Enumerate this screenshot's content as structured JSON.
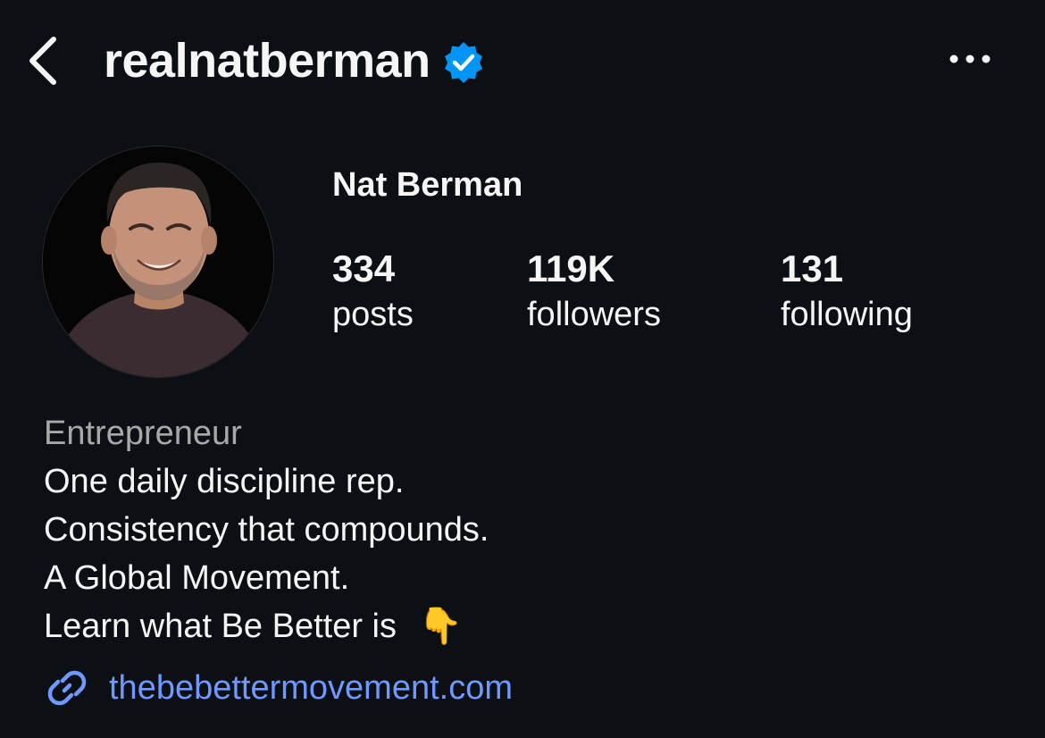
{
  "header": {
    "username": "realnatberman",
    "verified_icon": "verified-badge-icon",
    "back_icon": "chevron-left-icon",
    "more_icon": "more-options-icon",
    "accent_color": "#0095f6"
  },
  "profile": {
    "display_name": "Nat Berman",
    "stats": [
      {
        "value": "334",
        "label": "posts"
      },
      {
        "value": "119K",
        "label": "followers"
      },
      {
        "value": "131",
        "label": "following"
      }
    ]
  },
  "bio": {
    "category": "Entrepreneur",
    "lines": [
      "One daily discipline rep.",
      "Consistency that compounds.",
      "A Global Movement.",
      "Learn what Be Better is"
    ],
    "emoji": "👇",
    "link": "thebebettermovement.com",
    "link_icon": "link-icon",
    "link_color": "#6f99ff"
  }
}
